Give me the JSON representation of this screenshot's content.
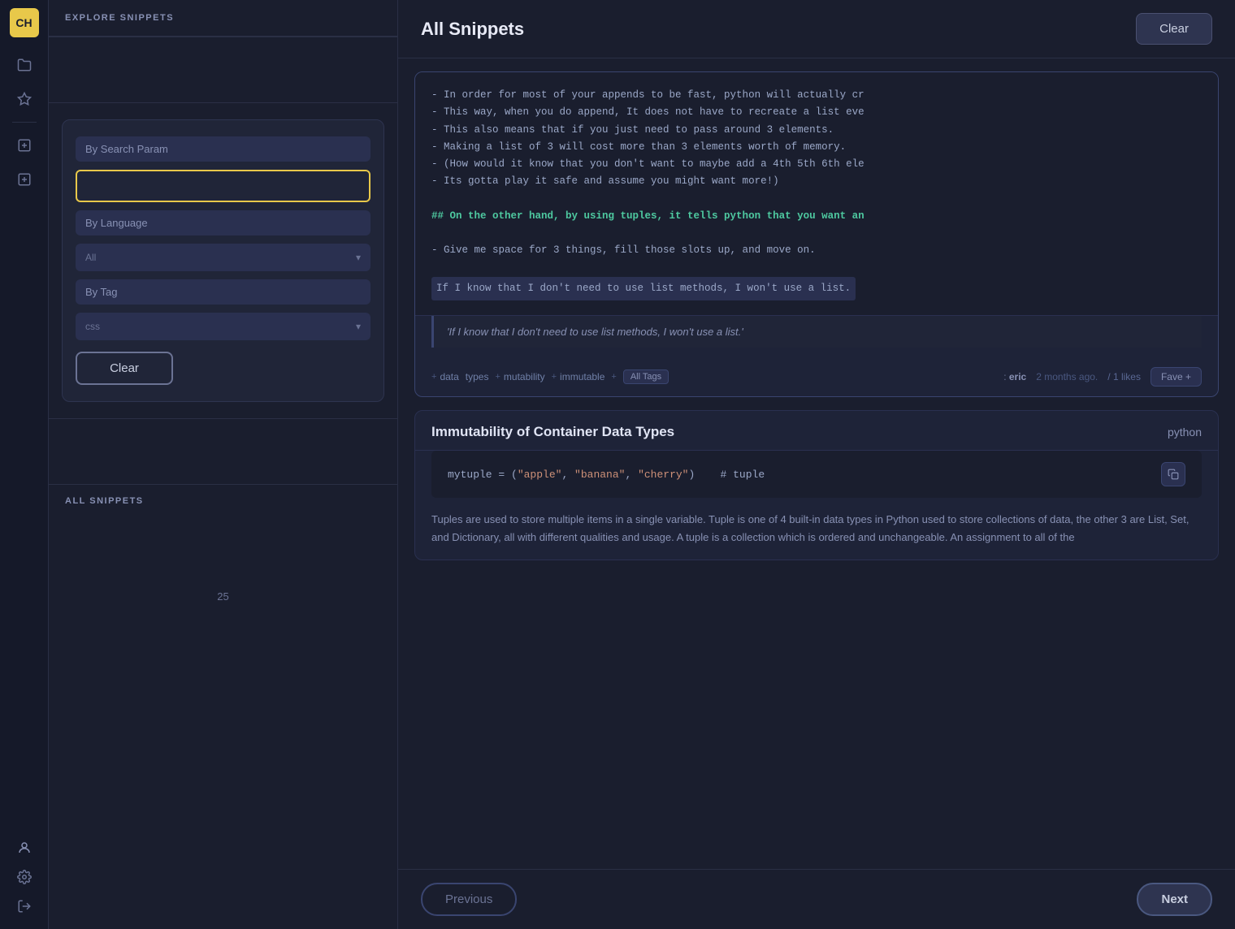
{
  "app": {
    "logo": "CH",
    "nav_icons": [
      "folder-icon",
      "star-icon",
      "add-icon",
      "add-alt-icon"
    ]
  },
  "sidebar": {
    "header": "Explore Snippets",
    "filter": {
      "by_search_param_label": "By Search Param",
      "search_placeholder": "",
      "by_language_label": "By Language",
      "language_value": "All",
      "by_tag_label": "By Tag",
      "tag_value": "css",
      "clear_btn": "Clear"
    },
    "section_title": "All Snippets",
    "page_number": "25"
  },
  "main": {
    "title": "All Snippets",
    "clear_btn": "Clear",
    "snippets": [
      {
        "id": "snippet-1",
        "code_lines": [
          "- In order for most of your appends to be fast, python will actually cr",
          "- This way, when you do append, It does not have to recreate a list eve",
          "- This also means that if you just need to pass around 3 elements.",
          "- Making a list of 3 will cost more than 3 elements worth of memory.",
          "- (How would it know that you don't want to maybe add a 4th 5th 6th ele",
          "- Its gotta play it safe and assume you might want more!)"
        ],
        "highlight_line": "## On the other hand, by using tuples, it tells python that you want an",
        "extra_line": "- Give me space for 3 things, fill those slots up, and move on.",
        "final_line": "If I know that I don't need to use list methods, I won't use a list.",
        "quote": "'If I know that I don't need to use list methods, I won't use a list.'",
        "tags": [
          {
            "prefix": "+ ",
            "name": "data"
          },
          {
            "prefix": "",
            "name": "types"
          },
          {
            "prefix": "+ ",
            "name": ""
          },
          {
            "prefix": "",
            "name": "mutability"
          },
          {
            "prefix": "+ ",
            "name": "immutable"
          },
          {
            "prefix": "+ ",
            "name": "All Tags"
          }
        ],
        "author": ": eric",
        "count": "2",
        "time_ago": "months ago.",
        "slash_count": "/ 1",
        "likes_label": "likes",
        "fave_btn": "Fave",
        "fave_plus": "+"
      },
      {
        "id": "snippet-2",
        "title": "Immutability of Container Data Types",
        "language": "python",
        "code": "mytuple = (\"apple\", \"banana\", \"cherry\")    # tuple",
        "code_str_parts": [
          "\"apple\"",
          "\"banana\"",
          "\"cherry\""
        ],
        "description": "Tuples are used to store multiple items in a single variable. Tuple is one of 4 built-in data types in Python used to store collections of data, the other 3 are List, Set, and Dictionary, all with different qualities and usage. A tuple is a collection which is ordered and unchangeable. An assignment to all of the"
      }
    ],
    "pagination": {
      "prev_btn": "Previous",
      "next_btn": "Next"
    }
  }
}
